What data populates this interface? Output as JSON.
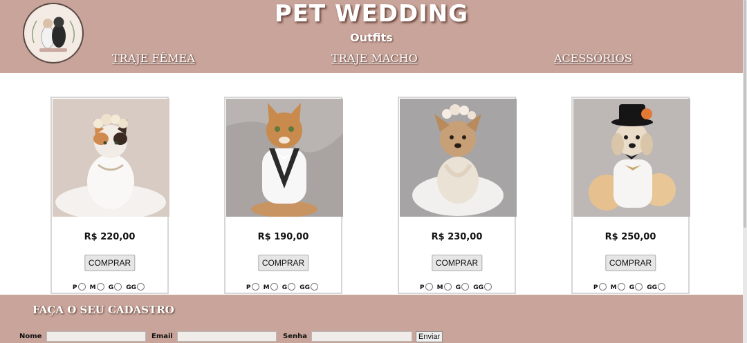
{
  "site": {
    "title": "PET WEDDING",
    "subtitle": "Outfits"
  },
  "nav": [
    {
      "label": "TRAJE FÊMEA"
    },
    {
      "label": "TRAJE MACHO"
    },
    {
      "label": "ACESSÓRIOS"
    }
  ],
  "products": [
    {
      "price": "R$ 220,00",
      "buy_label": "COMPRAR",
      "sizes": [
        "P",
        "M",
        "G",
        "GG"
      ]
    },
    {
      "price": "R$ 190,00",
      "buy_label": "COMPRAR",
      "sizes": [
        "P",
        "M",
        "G",
        "GG"
      ]
    },
    {
      "price": "R$ 230,00",
      "buy_label": "COMPRAR",
      "sizes": [
        "P",
        "M",
        "G",
        "GG"
      ]
    },
    {
      "price": "R$ 250,00",
      "buy_label": "COMPRAR",
      "sizes": [
        "P",
        "M",
        "G",
        "GG"
      ]
    }
  ],
  "signup": {
    "heading": "FAÇA O SEU CADASTRO",
    "name_label": "Nome",
    "email_label": "Email",
    "password_label": "Senha",
    "submit_label": "Enviar"
  },
  "colors": {
    "brand": "#c8a49a",
    "text_on_brand": "#ffffff"
  }
}
